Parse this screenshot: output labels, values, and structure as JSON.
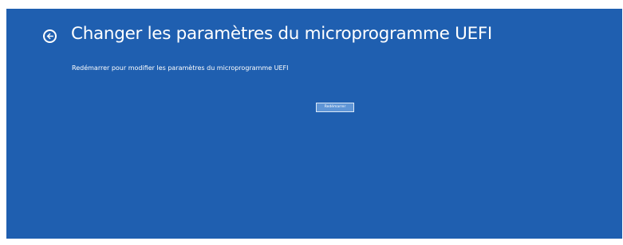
{
  "header": {
    "back_icon": "back-arrow-icon",
    "title": "Changer les paramètres du microprogramme UEFI"
  },
  "main": {
    "description": "Redémarrer pour modifier les paramètres du microprogramme UEFI",
    "restart_button_label": "Redémarrer"
  },
  "colors": {
    "background": "#1f5fb0",
    "text": "#ffffff",
    "button_fill": "#5f95d6"
  }
}
